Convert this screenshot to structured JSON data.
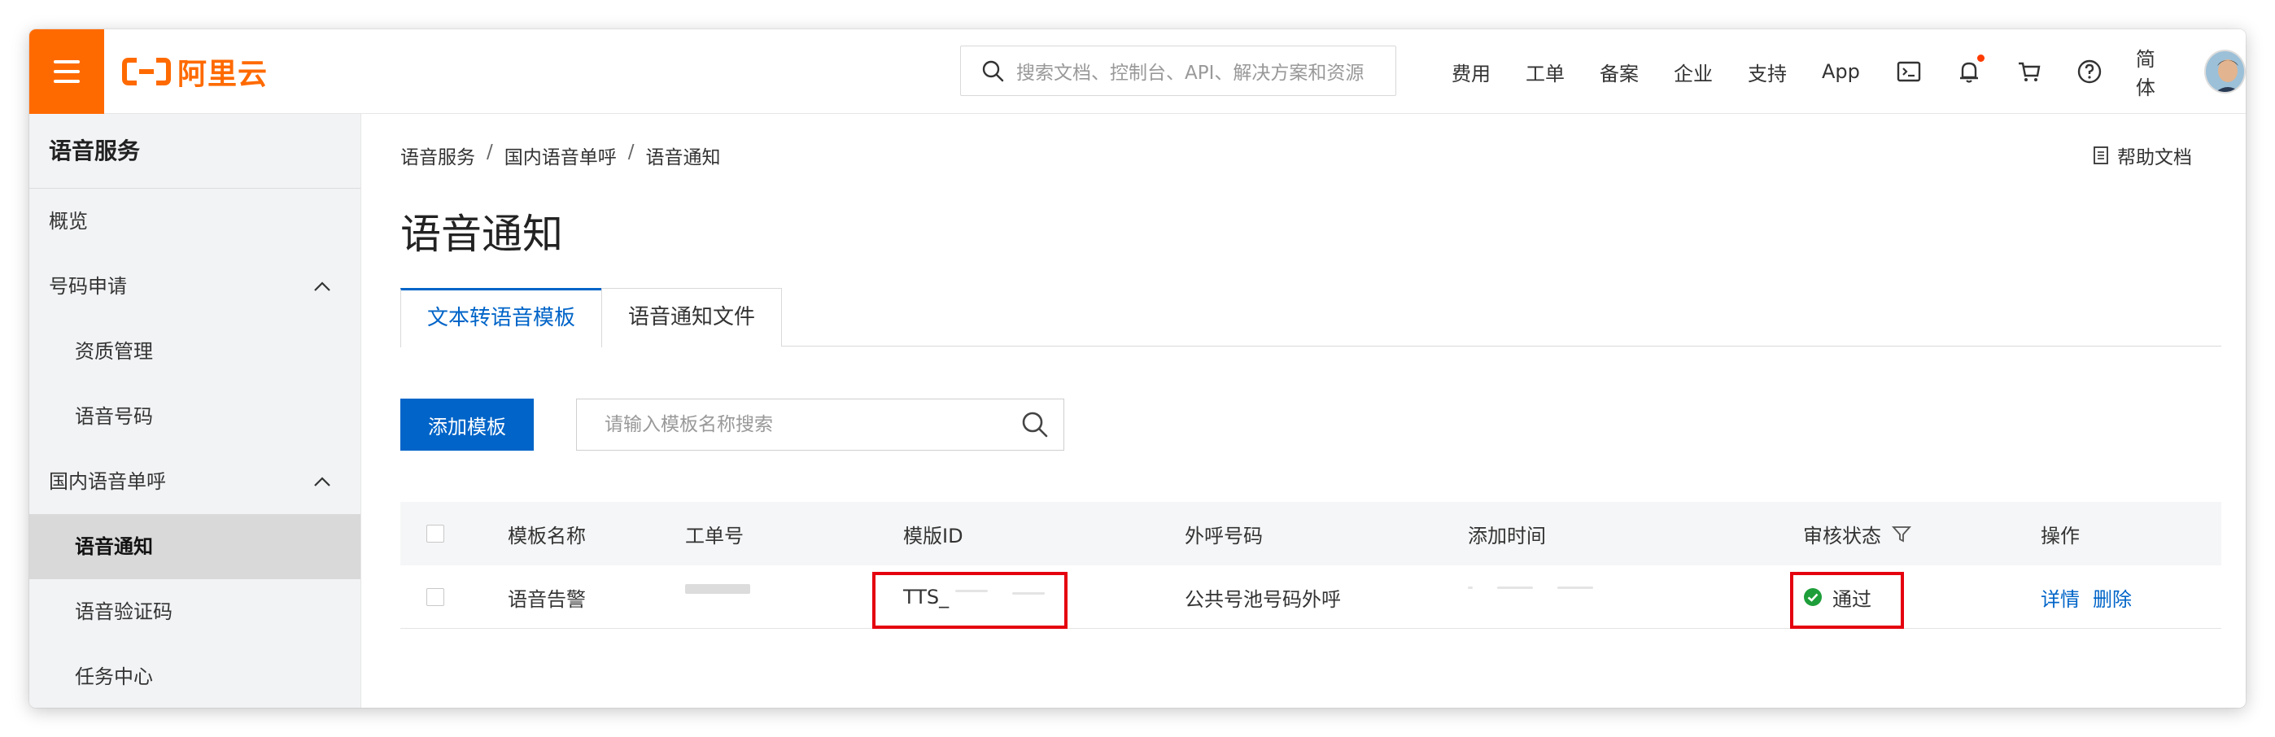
{
  "topbar": {
    "logo_text": "阿里云",
    "search_placeholder": "搜索文档、控制台、API、解决方案和资源",
    "nav": [
      "费用",
      "工单",
      "备案",
      "企业",
      "支持",
      "App"
    ],
    "lang": "简体",
    "icons": [
      "terminal-icon",
      "bell-icon",
      "cart-icon",
      "help-circle-icon"
    ]
  },
  "sidebar": {
    "title": "语音服务",
    "items": [
      {
        "label": "概览"
      },
      {
        "label": "号码申请"
      },
      {
        "label": "资质管理"
      },
      {
        "label": "语音号码"
      },
      {
        "label": "国内语音单呼"
      },
      {
        "label": "语音通知"
      },
      {
        "label": "语音验证码"
      },
      {
        "label": "任务中心"
      }
    ]
  },
  "main": {
    "breadcrumb": [
      "语音服务",
      "国内语音单呼",
      "语音通知"
    ],
    "help_doc": "帮助文档",
    "page_title": "语音通知",
    "tabs": [
      {
        "label": "文本转语音模板"
      },
      {
        "label": "语音通知文件"
      }
    ],
    "add_button": "添加模板",
    "search_placeholder": "请输入模板名称搜索",
    "table": {
      "columns": [
        "模板名称",
        "工单号",
        "模版ID",
        "外呼号码",
        "添加时间",
        "审核状态",
        "操作"
      ],
      "rows": [
        {
          "name": "语音告警",
          "template_id": "TTS_",
          "call_number": "公共号池号码外呼",
          "status": "通过",
          "actions": [
            "详情",
            "删除"
          ]
        }
      ]
    }
  },
  "colors": {
    "brand_orange": "#ff6a00",
    "primary_blue": "#0064c8",
    "status_green": "#1e9e3a",
    "highlight_red": "#e5000f"
  }
}
